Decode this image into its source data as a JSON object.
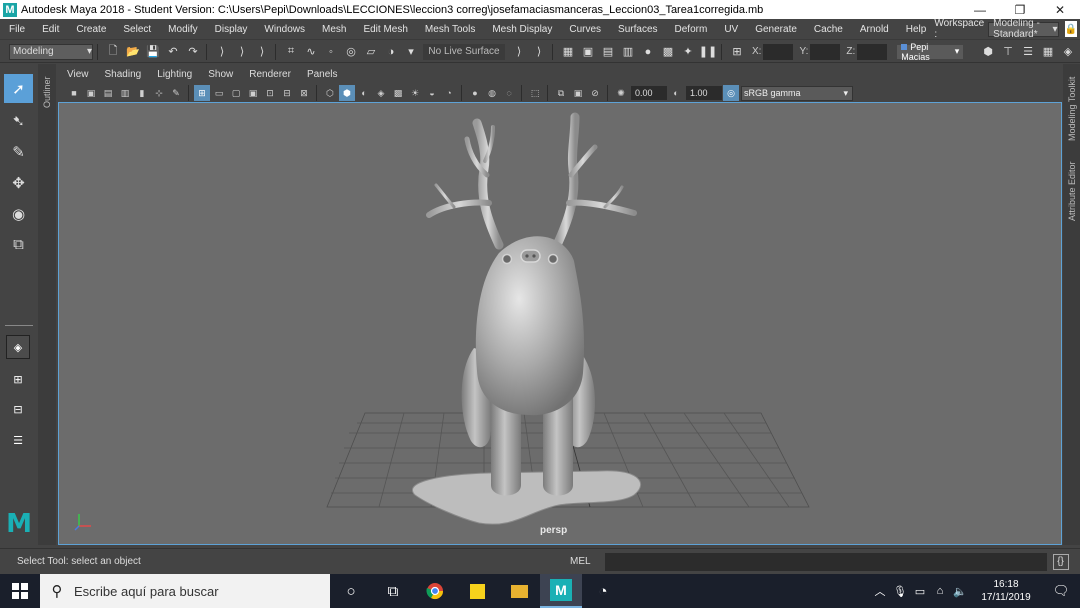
{
  "window": {
    "logo_letter": "M",
    "title": "Autodesk Maya 2018 - Student Version: C:\\Users\\Pepi\\Downloads\\LECCIONES\\leccion3 correg\\josefamaciasmanceras_Leccion03_Tarea1corregida.mb",
    "minimize": "—",
    "restore": "❐",
    "close": "✕"
  },
  "menubar": {
    "items": [
      "File",
      "Edit",
      "Create",
      "Select",
      "Modify",
      "Display",
      "Windows",
      "Mesh",
      "Edit Mesh",
      "Mesh Tools",
      "Mesh Display",
      "Curves",
      "Surfaces",
      "Deform",
      "UV",
      "Generate",
      "Cache",
      "Arnold",
      "Help"
    ],
    "workspace_label": "Workspace :",
    "workspace_value": "Modeling - Standard*"
  },
  "statusline": {
    "mode": "Modeling",
    "live_surface": "No Live Surface",
    "x_label": "X:",
    "y_label": "Y:",
    "z_label": "Z:",
    "user": "Pepi Macias"
  },
  "toolbox": {
    "logo_letter": "M"
  },
  "side_tabs": {
    "outliner": "Outliner",
    "modeling_toolkit": "Modeling Toolkit",
    "attribute_editor": "Attribute Editor"
  },
  "panel": {
    "menu": [
      "View",
      "Shading",
      "Lighting",
      "Show",
      "Renderer",
      "Panels"
    ],
    "exposure": "0.00",
    "gamma": "1.00",
    "color_space": "sRGB gamma",
    "camera": "persp"
  },
  "helpline": {
    "text": "Select Tool: select an object",
    "mel_label": "MEL"
  },
  "taskbar": {
    "search_placeholder": "Escribe aquí para buscar",
    "time": "16:18",
    "date": "17/11/2019"
  },
  "colors": {
    "accent": "#5ba0d8",
    "viewport_bg": "#6c6c6c",
    "maya_teal": "#1ab0b5"
  }
}
